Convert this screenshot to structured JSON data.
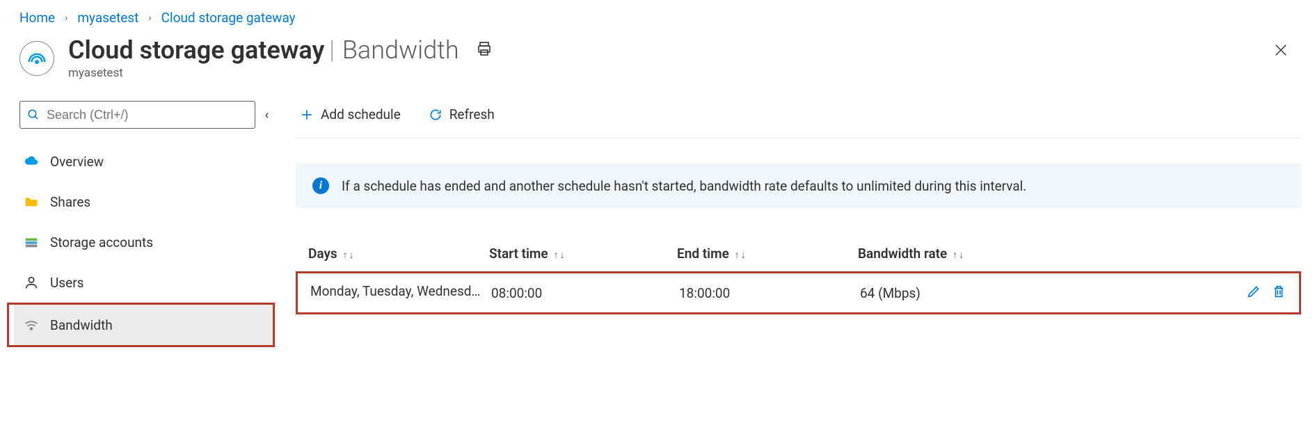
{
  "breadcrumb": {
    "home": "Home",
    "resource": "myasetest",
    "current": "Cloud storage gateway"
  },
  "header": {
    "title": "Cloud storage gateway",
    "section": "Bandwidth",
    "subtitle": "myasetest"
  },
  "sidebar": {
    "search_placeholder": "Search (Ctrl+/)",
    "items": [
      {
        "key": "overview",
        "label": "Overview"
      },
      {
        "key": "shares",
        "label": "Shares"
      },
      {
        "key": "storage-accounts",
        "label": "Storage accounts"
      },
      {
        "key": "users",
        "label": "Users"
      },
      {
        "key": "bandwidth",
        "label": "Bandwidth"
      }
    ]
  },
  "toolbar": {
    "add_schedule": "Add schedule",
    "refresh": "Refresh"
  },
  "info": {
    "message": "If a schedule has ended and another schedule hasn't started, bandwidth rate defaults to unlimited during this interval."
  },
  "table": {
    "columns": {
      "days": "Days",
      "start_time": "Start time",
      "end_time": "End time",
      "bandwidth_rate": "Bandwidth rate"
    },
    "rows": [
      {
        "days": "Monday, Tuesday, Wednesd…",
        "start_time": "08:00:00",
        "end_time": "18:00:00",
        "bandwidth_rate": "64 (Mbps)"
      }
    ]
  }
}
